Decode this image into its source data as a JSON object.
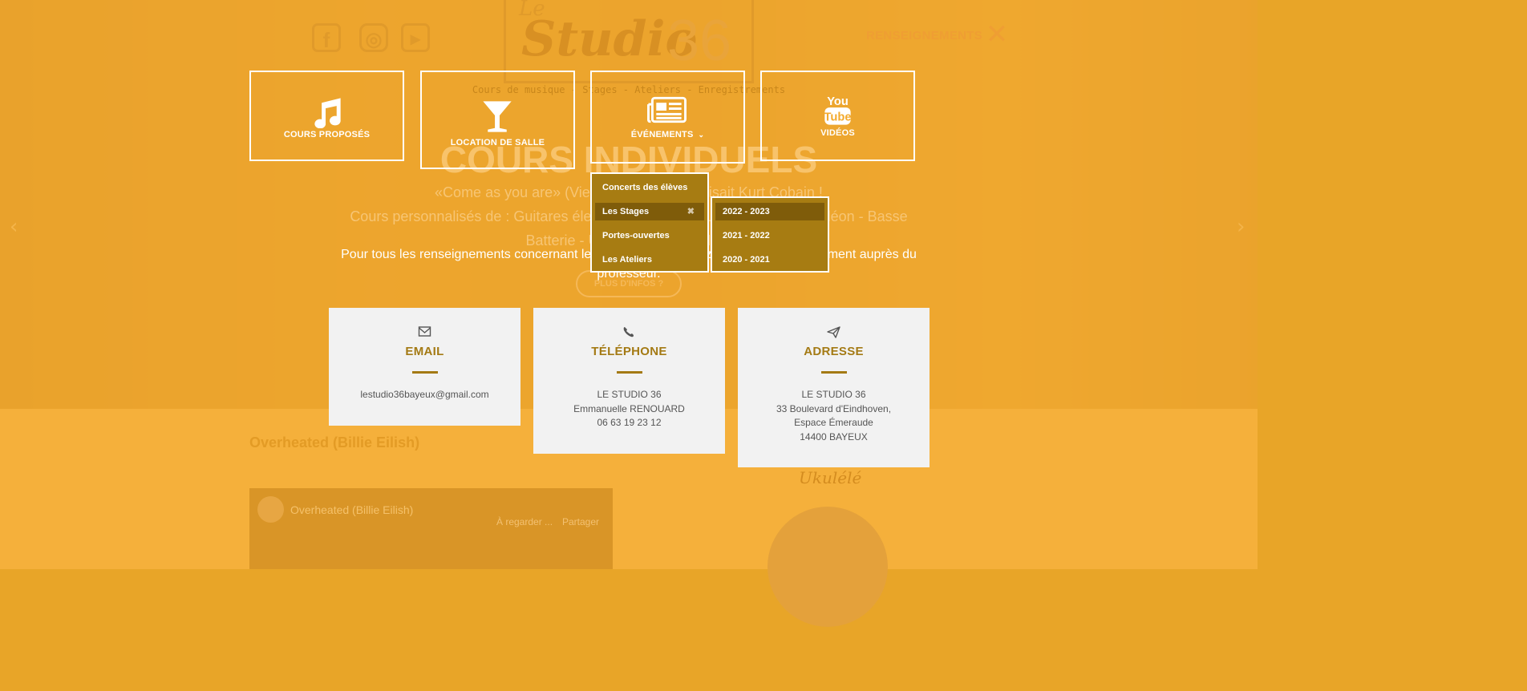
{
  "header": {
    "logo": {
      "le": "Le",
      "studio": "Studio",
      "number": "36"
    },
    "tagline": "Cours de musique - Stages - Ateliers - Enregistrements",
    "social": [
      {
        "name": "facebook",
        "glyph": "f"
      },
      {
        "name": "instagram",
        "glyph": "◎"
      },
      {
        "name": "youtube",
        "glyph": "▶"
      }
    ],
    "contact_label": "RENSEIGNEMENTS",
    "close_glyph": "✕"
  },
  "hero": {
    "title": "COURS INDIVIDUELS",
    "line1": "«Come as you are» (Viens comme tu es) disait Kurt Cobain !",
    "line2": "Cours personnalisés de : Guitares électrique & acoustique - Chant - Accordéon - Basse",
    "line3": "Batterie - Ukulélé - Piano - MAO",
    "more_button": "PLUS D'INFOS ?",
    "prev_arrow": "‹",
    "next_arrow": "›"
  },
  "lower": {
    "section_title": "Overheated (Billie Eilish)",
    "video": {
      "title": "Overheated (Billie Eilish)",
      "watch_later": "À regarder ...",
      "share": "Partager"
    },
    "ukulele_label": "Ukulélé"
  },
  "menu": {
    "tiles": [
      {
        "label": "COURS PROPOSÉS",
        "icon": "music-note-icon"
      },
      {
        "label": "LOCATION DE SALLE",
        "icon": "cocktail-glass-icon"
      },
      {
        "label": "ÉVÉNEMENTS",
        "icon": "newspaper-icon",
        "chevron": "⌄"
      },
      {
        "label": "VIDÉOS",
        "icon": "youtube-icon"
      }
    ],
    "events_dropdown": [
      {
        "label": "Concerts des élèves"
      },
      {
        "label": "Les Stages",
        "close": "✖"
      },
      {
        "label": "Portes-ouvertes"
      },
      {
        "label": "Les Ateliers"
      }
    ],
    "stages_dropdown": [
      {
        "label": "2022 - 2023"
      },
      {
        "label": "2021 - 2022"
      },
      {
        "label": "2020 - 2021"
      }
    ]
  },
  "info": {
    "line1": "Pour tous les renseignements concernant les cours, vous pouvez nous joindre directement auprès du",
    "line2": "professeur."
  },
  "contact_cards": {
    "email": {
      "title": "EMAIL",
      "icon": "envelope-icon",
      "lines": [
        "lestudio36bayeux@gmail.com"
      ]
    },
    "phone": {
      "title": "TÉLÉPHONE",
      "icon": "phone-icon",
      "lines": [
        "LE STUDIO 36",
        "Emmanuelle RENOUARD",
        "06 63 19 23 12"
      ]
    },
    "address": {
      "title": "ADRESSE",
      "icon": "paper-plane-icon",
      "lines": [
        "LE STUDIO 36",
        "33 Boulevard d'Eindhoven,",
        "Espace Émeraude",
        "14400 BAYEUX"
      ]
    }
  },
  "colors": {
    "overlay": "#f4aa2c",
    "dropdown": "#a77c12",
    "dropdown_active": "#7f5c0a",
    "card_bg": "#f2f2f2",
    "card_accent": "#a47a14"
  }
}
